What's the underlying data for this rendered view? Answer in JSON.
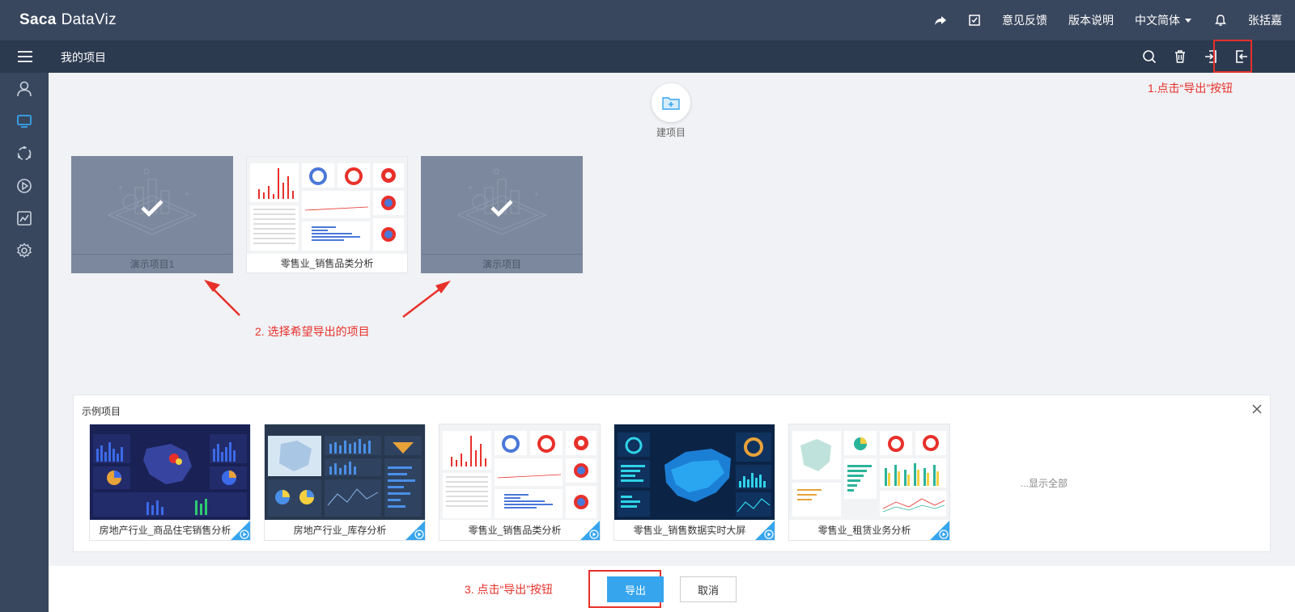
{
  "app": {
    "logo_prefix": "Saca",
    "logo_suffix": "DataViz"
  },
  "topnav": {
    "feedback": "意见反馈",
    "release_notes": "版本说明",
    "language": "中文简体",
    "user": "张括嘉"
  },
  "subheader": {
    "title": "我的项目"
  },
  "new_project": {
    "label": "建项目"
  },
  "projects": [
    {
      "name": "演示项目1",
      "selected": true
    },
    {
      "name": "零售业_销售品类分析",
      "selected": false
    },
    {
      "name": "演示项目",
      "selected": true
    }
  ],
  "annotations": {
    "step1": "1.点击“导出”按钮",
    "step2": "2. 选择希望导出的项目",
    "step3": "3. 点击“导出”按钮"
  },
  "samples": {
    "title": "示例项目",
    "items": [
      {
        "name": "房地产行业_商品住宅销售分析"
      },
      {
        "name": "房地产行业_库存分析"
      },
      {
        "name": "零售业_销售品类分析"
      },
      {
        "name": "零售业_销售数据实时大屏"
      },
      {
        "name": "零售业_租赁业务分析"
      }
    ],
    "show_all": "...显示全部"
  },
  "footer": {
    "export_label": "导出",
    "cancel_label": "取消"
  },
  "colors": {
    "header_bg": "#39475e",
    "subheader_bg": "#2c3a50",
    "accent": "#36a5ee",
    "annotation_red": "#e8302a",
    "selected_overlay": "#7c889d"
  }
}
